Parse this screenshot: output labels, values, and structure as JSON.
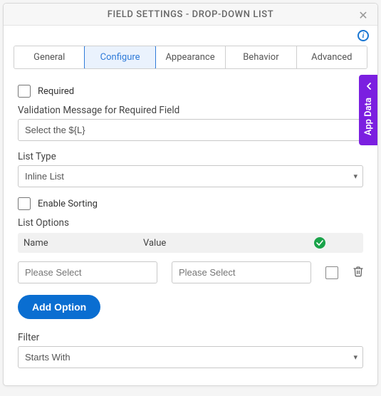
{
  "header": {
    "title": "FIELD SETTINGS - DROP-DOWN LIST"
  },
  "tabs": [
    "General",
    "Configure",
    "Appearance",
    "Behavior",
    "Advanced"
  ],
  "activeTab": "Configure",
  "configure": {
    "required_label": "Required",
    "validation_label": "Validation Message for Required Field",
    "validation_value": "Select the ${L}",
    "list_type_label": "List Type",
    "list_type_value": "Inline List",
    "enable_sorting_label": "Enable Sorting",
    "list_options_label": "List Options",
    "columns": {
      "name": "Name",
      "value": "Value"
    },
    "row": {
      "name_placeholder": "Please Select",
      "value_placeholder": "Please Select"
    },
    "add_option_label": "Add Option",
    "filter_label": "Filter",
    "filter_value": "Starts With"
  },
  "side_panel": {
    "label": "App Data"
  }
}
